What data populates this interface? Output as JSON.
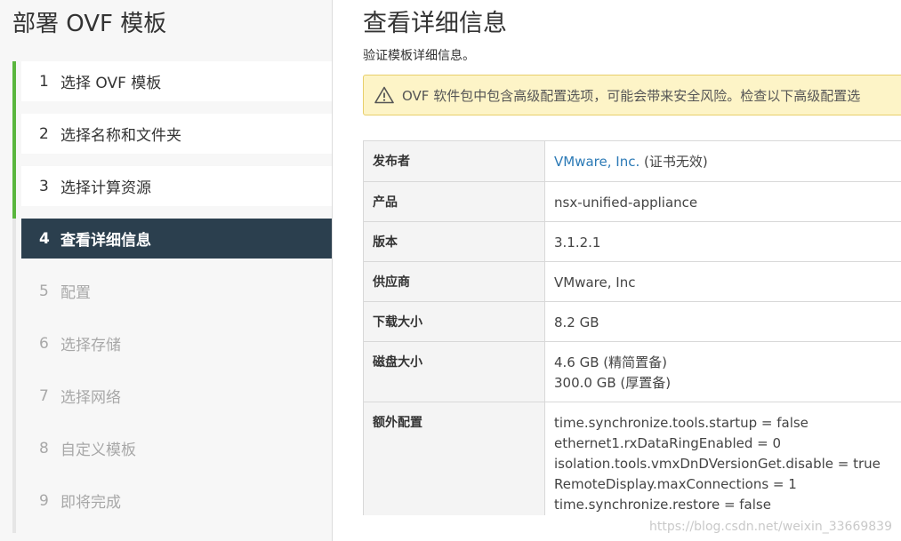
{
  "wizard": {
    "title": "部署 OVF 模板",
    "steps": [
      {
        "num": "1",
        "label": "选择 OVF 模板"
      },
      {
        "num": "2",
        "label": "选择名称和文件夹"
      },
      {
        "num": "3",
        "label": "选择计算资源"
      },
      {
        "num": "4",
        "label": "查看详细信息"
      },
      {
        "num": "5",
        "label": "配置"
      },
      {
        "num": "6",
        "label": "选择存储"
      },
      {
        "num": "7",
        "label": "选择网络"
      },
      {
        "num": "8",
        "label": "自定义模板"
      },
      {
        "num": "9",
        "label": "即将完成"
      }
    ]
  },
  "main": {
    "title": "查看详细信息",
    "subtitle": "验证模板详细信息。",
    "warning": "OVF 软件包中包含高级配置选项，可能会带来安全风险。检查以下高级配置选",
    "details": {
      "publisher_label": "发布者",
      "publisher_link": "VMware, Inc.",
      "publisher_note": " (证书无效)",
      "product_label": "产品",
      "product_value": "nsx-unified-appliance",
      "version_label": "版本",
      "version_value": "3.1.2.1",
      "vendor_label": "供应商",
      "vendor_value": "VMware, Inc",
      "download_label": "下载大小",
      "download_value": "8.2 GB",
      "disk_label": "磁盘大小",
      "disk_line1": "4.6 GB (精简置备)",
      "disk_line2": "300.0 GB (厚置备)",
      "extra_label": "额外配置",
      "extra_lines": [
        "time.synchronize.tools.startup = false",
        "ethernet1.rxDataRingEnabled = 0",
        "isolation.tools.vmxDnDVersionGet.disable = true",
        "RemoteDisplay.maxConnections = 1",
        "time.synchronize.restore = false"
      ]
    }
  },
  "watermark": "https://blog.csdn.net/weixin_33669839",
  "colors": {
    "active_step_bg": "#2b3f4e",
    "done_rail": "#5ab63e",
    "warning_bg": "#fdf4c7",
    "link": "#2c7ab6"
  }
}
